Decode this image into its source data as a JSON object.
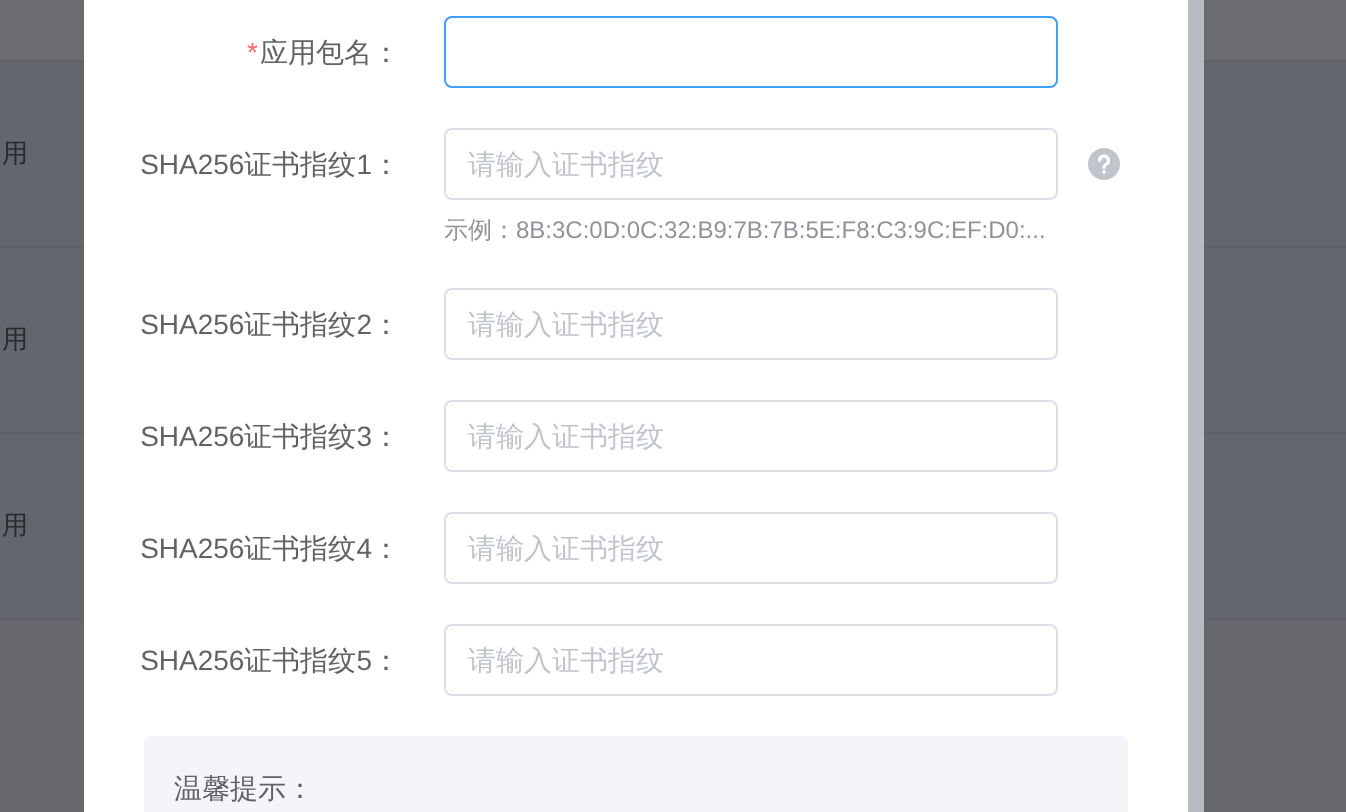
{
  "background_table": {
    "rows": [
      {
        "cell": "用"
      },
      {
        "cell": "用"
      },
      {
        "cell": "用"
      }
    ]
  },
  "dialog": {
    "fields": [
      {
        "label": "应用包名：",
        "required_mark": "*",
        "focused": true
      },
      {
        "label": "SHA256证书指纹1：",
        "focused": false,
        "placeholder": "请输入证书指纹",
        "hint": "示例：8B:3C:0D:0C:32:B9:7B:7B:5E:F8:C3:9C:EF:D0:...",
        "help": true
      },
      {
        "label": "SHA256证书指纹2：",
        "focused": false,
        "placeholder": "请输入证书指纹"
      },
      {
        "label": "SHA256证书指纹3：",
        "focused": false,
        "placeholder": "请输入证书指纹"
      },
      {
        "label": "SHA256证书指纹4：",
        "focused": false,
        "placeholder": "请输入证书指纹"
      },
      {
        "label": "SHA256证书指纹5：",
        "focused": false,
        "placeholder": "请输入证书指纹"
      }
    ],
    "tip": {
      "title": "温馨提示："
    }
  }
}
